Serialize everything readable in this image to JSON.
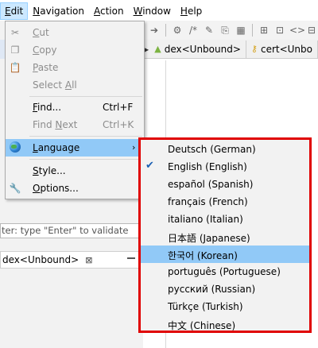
{
  "menubar": {
    "items": [
      {
        "mnemonic": "E",
        "rest": "dit"
      },
      {
        "mnemonic": "N",
        "rest": "avigation"
      },
      {
        "mnemonic": "A",
        "rest": "ction"
      },
      {
        "mnemonic": "W",
        "rest": "indow"
      },
      {
        "mnemonic": "H",
        "rest": "elp"
      }
    ]
  },
  "left_pane": {
    "validate_hint": "ter: type \"Enter\" to validate",
    "dex_tab_label": "dex<Unbound>",
    "dex_tab_close": "⊠"
  },
  "editor_tabs": [
    {
      "label": "dex<Unbound>",
      "icon": "android-icon"
    },
    {
      "label": "cert<Unbo",
      "icon": "key-icon"
    }
  ],
  "edit_menu": {
    "cut": {
      "mn": "C",
      "rest": "ut"
    },
    "copy": {
      "mn": "C",
      "rest": "opy"
    },
    "paste": {
      "mn": "P",
      "rest": "aste"
    },
    "select_all": {
      "pre": "Select ",
      "mn": "A",
      "rest": "ll"
    },
    "find": {
      "mn": "F",
      "rest": "ind...",
      "accel": "Ctrl+F"
    },
    "find_next": {
      "pre": "Find ",
      "mn": "N",
      "rest": "ext",
      "accel": "Ctrl+K"
    },
    "language": {
      "mn": "L",
      "rest": "anguage",
      "arrow": "›"
    },
    "style": {
      "mn": "S",
      "rest": "tyle..."
    },
    "options": {
      "mn": "O",
      "rest": "ptions..."
    }
  },
  "language_menu": {
    "items": [
      {
        "label": "Deutsch (German)",
        "checked": false
      },
      {
        "label": "English (English)",
        "checked": true
      },
      {
        "label": "español (Spanish)",
        "checked": false
      },
      {
        "label": "français (French)",
        "checked": false
      },
      {
        "label": "italiano (Italian)",
        "checked": false
      },
      {
        "label": "日本語 (Japanese)",
        "checked": false
      },
      {
        "label": "한국어 (Korean)",
        "checked": false
      },
      {
        "label": "português (Portuguese)",
        "checked": false
      },
      {
        "label": "русский (Russian)",
        "checked": false
      },
      {
        "label": "Türkçe (Turkish)",
        "checked": false
      },
      {
        "label": "中文 (Chinese)",
        "checked": false
      }
    ],
    "highlighted": "한국어 (Korean)"
  },
  "colors": {
    "highlight": "#91c9f7",
    "menu_bg": "#f2f2f2",
    "annotation_border": "#e00000",
    "menubar_active": "#cce8ff"
  }
}
